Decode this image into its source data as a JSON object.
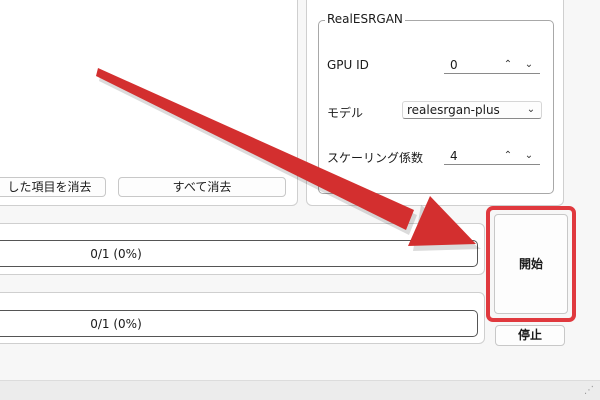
{
  "list_panel": {
    "clear_selected_label": "した項目を消去",
    "clear_all_label": "すべて消去"
  },
  "settings": {
    "group_title": "RealESRGAN",
    "gpu_id": {
      "label": "GPU ID",
      "value": "0"
    },
    "model": {
      "label": "モデル",
      "value": "realesrgan-plus"
    },
    "scaling": {
      "label": "スケーリング係数",
      "value": "4"
    }
  },
  "progress": {
    "overall": {
      "text": "0/1 (0%)",
      "fraction": 0
    },
    "current": {
      "text": "0/1 (0%)",
      "fraction": 0
    }
  },
  "actions": {
    "start_label": "開始",
    "stop_label": "停止"
  },
  "annotation": {
    "arrow_color": "#d32f2f",
    "highlight_color": "#e0393e"
  }
}
